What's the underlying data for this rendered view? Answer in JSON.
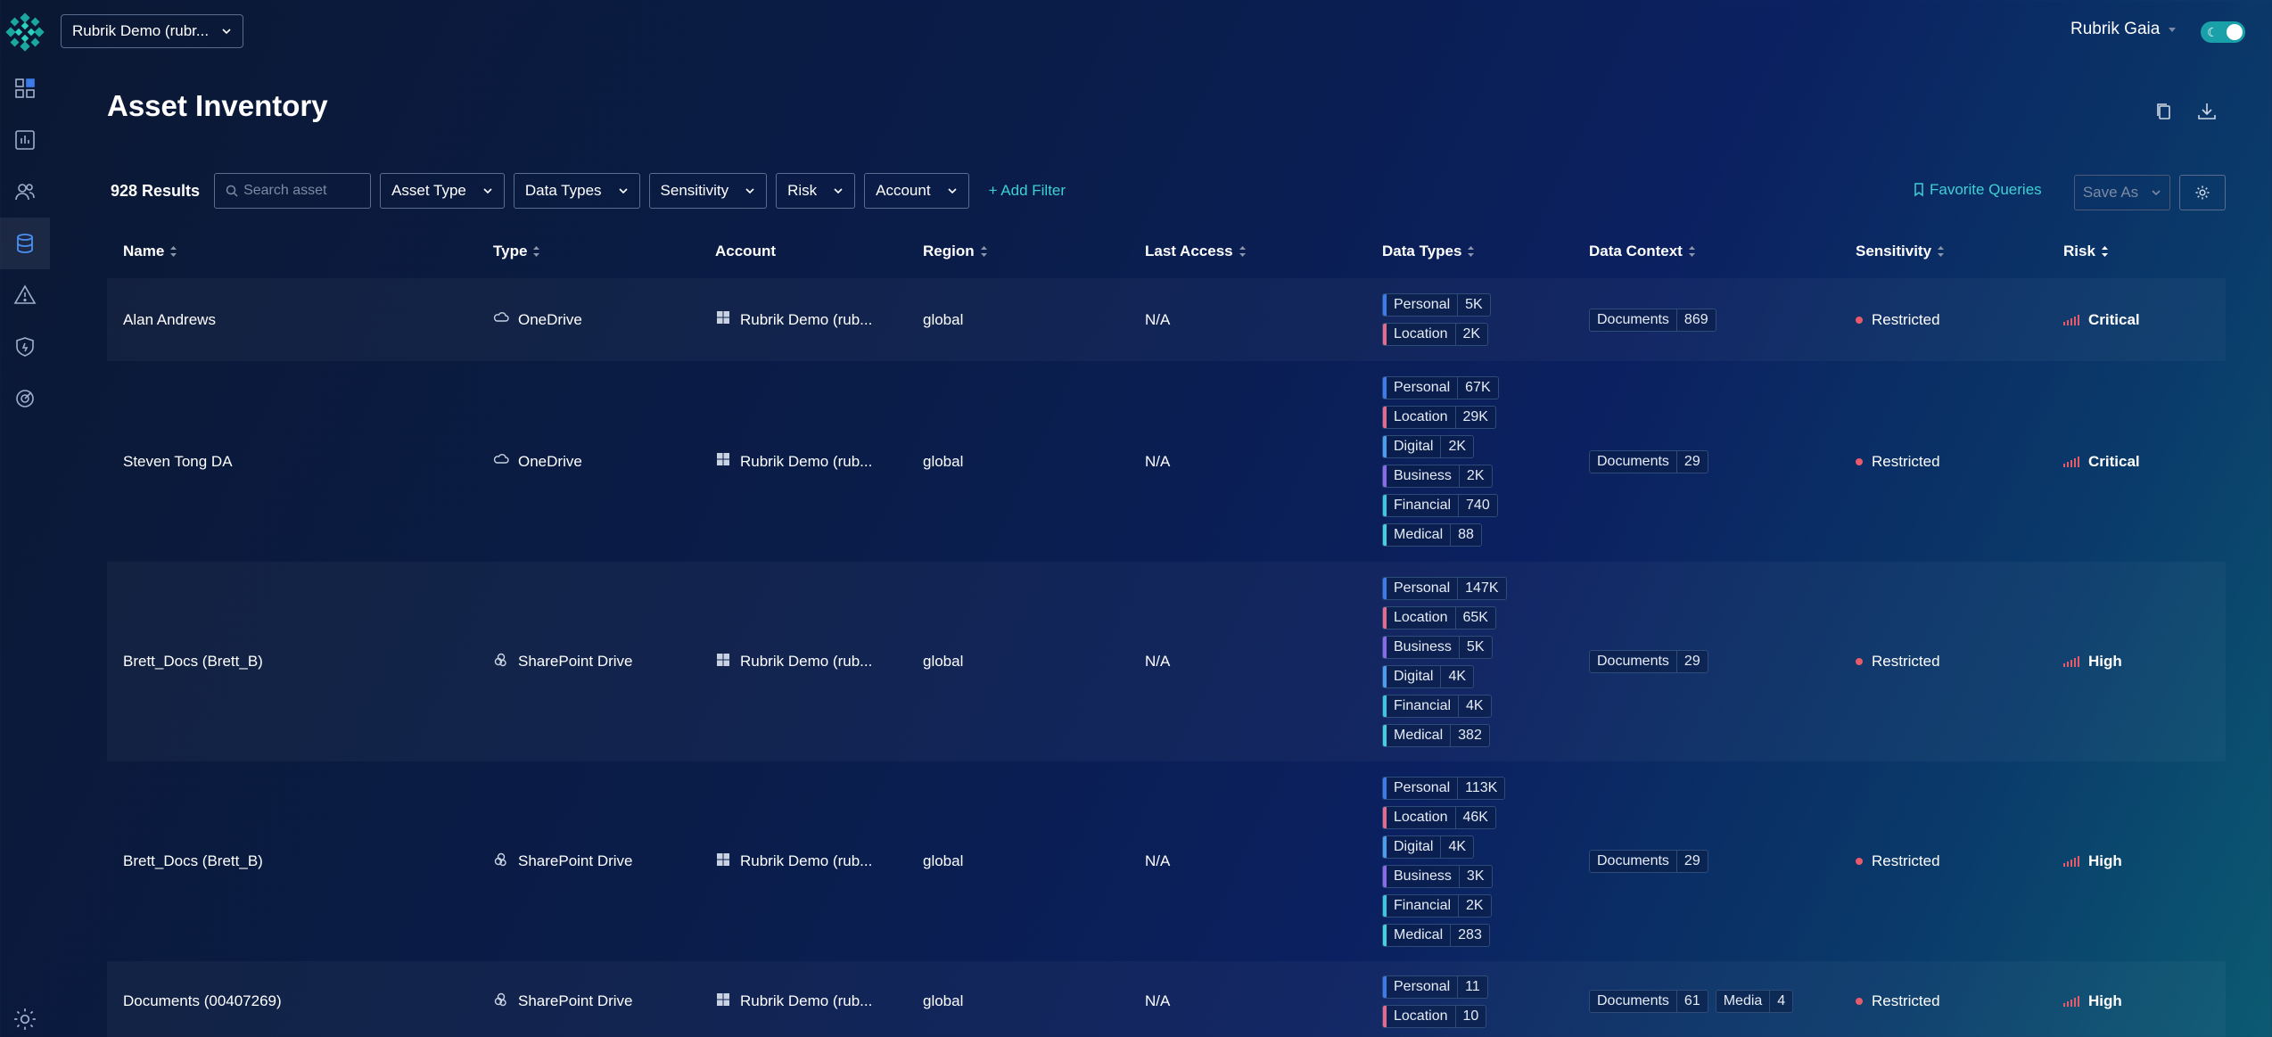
{
  "header": {
    "tenant": "Rubrik Demo (rubr...",
    "user": "Rubrik Gaia"
  },
  "page": {
    "title": "Asset Inventory"
  },
  "filters": {
    "results": "928 Results",
    "search_placeholder": "Search asset",
    "buttons": [
      "Asset Type",
      "Data Types",
      "Sensitivity",
      "Risk",
      "Account"
    ],
    "add_filter": "+ Add Filter",
    "favorite_queries": "Favorite Queries",
    "save_as": "Save As"
  },
  "columns": [
    "Name",
    "Type",
    "Account",
    "Region",
    "Last Access",
    "Data Types",
    "Data Context",
    "Sensitivity",
    "Risk"
  ],
  "rows": [
    {
      "name": "Alan Andrews",
      "type": "OneDrive",
      "account": "Rubrik Demo (rub...",
      "region": "global",
      "last_access": "N/A",
      "data_types": [
        {
          "label": "Personal",
          "count": "5K",
          "color": "#3b7bea"
        },
        {
          "label": "Location",
          "count": "2K",
          "color": "#e86a8a"
        }
      ],
      "data_context": [
        {
          "label": "Documents",
          "count": "869"
        }
      ],
      "sensitivity": "Restricted",
      "risk": "Critical"
    },
    {
      "name": "Steven Tong DA",
      "type": "OneDrive",
      "account": "Rubrik Demo (rub...",
      "region": "global",
      "last_access": "N/A",
      "data_types": [
        {
          "label": "Personal",
          "count": "67K",
          "color": "#3b7bea"
        },
        {
          "label": "Location",
          "count": "29K",
          "color": "#e86a8a"
        },
        {
          "label": "Digital",
          "count": "2K",
          "color": "#4a9ef0"
        },
        {
          "label": "Business",
          "count": "2K",
          "color": "#8a6ae8"
        },
        {
          "label": "Financial",
          "count": "740",
          "color": "#3ac8e0"
        },
        {
          "label": "Medical",
          "count": "88",
          "color": "#40d0e0"
        }
      ],
      "data_context": [
        {
          "label": "Documents",
          "count": "29"
        }
      ],
      "sensitivity": "Restricted",
      "risk": "Critical"
    },
    {
      "name": "Brett_Docs (Brett_B)",
      "type": "SharePoint Drive",
      "account": "Rubrik Demo (rub...",
      "region": "global",
      "last_access": "N/A",
      "data_types": [
        {
          "label": "Personal",
          "count": "147K",
          "color": "#3b7bea"
        },
        {
          "label": "Location",
          "count": "65K",
          "color": "#e86a8a"
        },
        {
          "label": "Business",
          "count": "5K",
          "color": "#8a6ae8"
        },
        {
          "label": "Digital",
          "count": "4K",
          "color": "#4a9ef0"
        },
        {
          "label": "Financial",
          "count": "4K",
          "color": "#3ac8e0"
        },
        {
          "label": "Medical",
          "count": "382",
          "color": "#40d0e0"
        }
      ],
      "data_context": [
        {
          "label": "Documents",
          "count": "29"
        }
      ],
      "sensitivity": "Restricted",
      "risk": "High"
    },
    {
      "name": "Brett_Docs (Brett_B)",
      "type": "SharePoint Drive",
      "account": "Rubrik Demo (rub...",
      "region": "global",
      "last_access": "N/A",
      "data_types": [
        {
          "label": "Personal",
          "count": "113K",
          "color": "#3b7bea"
        },
        {
          "label": "Location",
          "count": "46K",
          "color": "#e86a8a"
        },
        {
          "label": "Digital",
          "count": "4K",
          "color": "#4a9ef0"
        },
        {
          "label": "Business",
          "count": "3K",
          "color": "#8a6ae8"
        },
        {
          "label": "Financial",
          "count": "2K",
          "color": "#3ac8e0"
        },
        {
          "label": "Medical",
          "count": "283",
          "color": "#40d0e0"
        }
      ],
      "data_context": [
        {
          "label": "Documents",
          "count": "29"
        }
      ],
      "sensitivity": "Restricted",
      "risk": "High"
    },
    {
      "name": "Documents (00407269)",
      "type": "SharePoint Drive",
      "account": "Rubrik Demo (rub...",
      "region": "global",
      "last_access": "N/A",
      "data_types": [
        {
          "label": "Personal",
          "count": "11",
          "color": "#3b7bea"
        },
        {
          "label": "Location",
          "count": "10",
          "color": "#e86a8a"
        }
      ],
      "data_context": [
        {
          "label": "Documents",
          "count": "61"
        },
        {
          "label": "Media",
          "count": "4"
        }
      ],
      "sensitivity": "Restricted",
      "risk": "High"
    }
  ]
}
